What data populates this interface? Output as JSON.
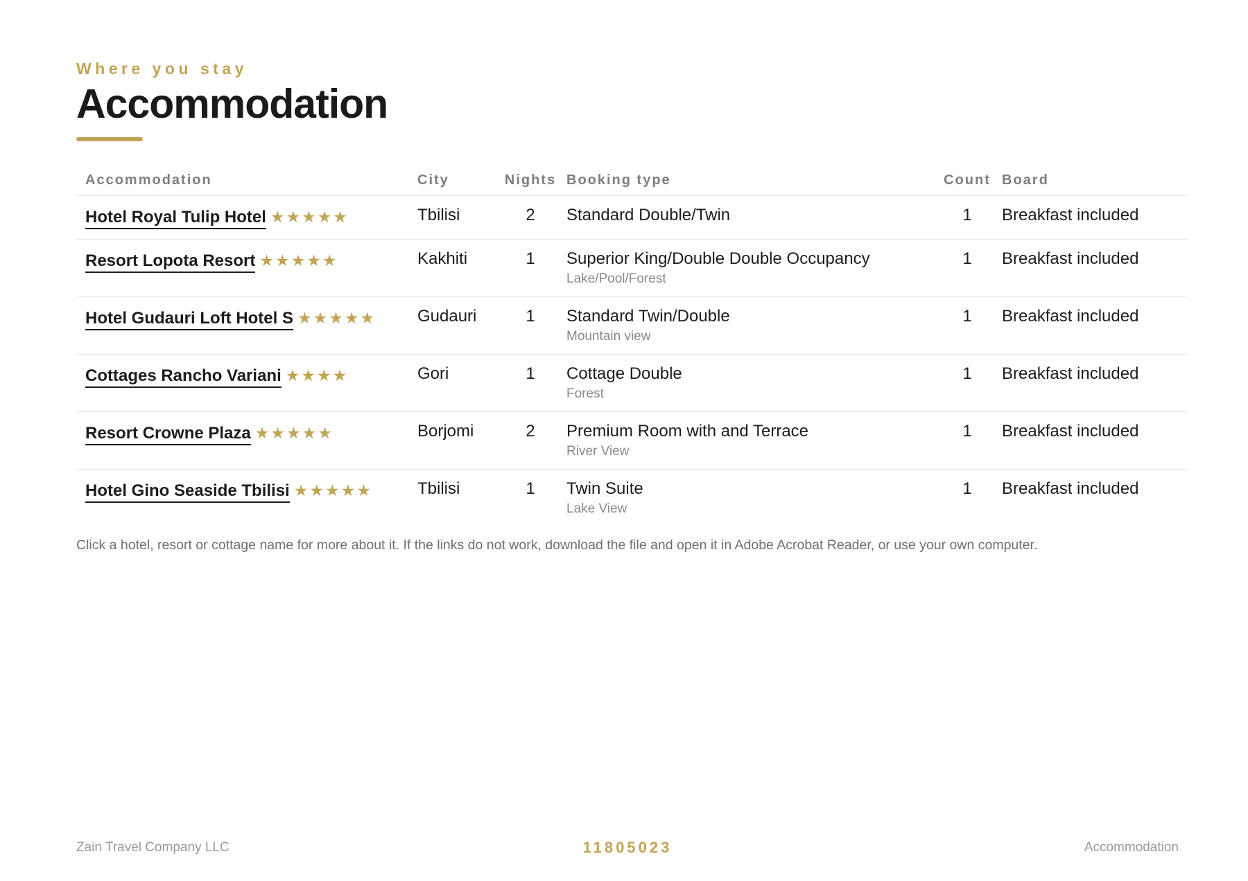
{
  "header": {
    "eyebrow": "Where you stay",
    "title": "Accommodation"
  },
  "table": {
    "columns": [
      "Accommodation",
      "City",
      "Nights",
      "Booking type",
      "Count",
      "Board"
    ],
    "rows": [
      {
        "name": "Hotel Royal Tulip Hotel",
        "stars": "★★★★★",
        "star_rating": 5,
        "city": "Tbilisi",
        "nights": "2",
        "booking_type": "Standard Double/Twin",
        "booking_note": "",
        "count": "1",
        "board": "Breakfast included"
      },
      {
        "name": "Resort Lopota Resort",
        "stars": "★★★★★",
        "star_rating": 5,
        "city": "Kakhiti",
        "nights": "1",
        "booking_type": "Superior King/Double Double Occupancy",
        "booking_note": "Lake/Pool/Forest",
        "count": "1",
        "board": "Breakfast included"
      },
      {
        "name": "Hotel Gudauri Loft Hotel S",
        "stars": "★★★★★",
        "star_rating": 5,
        "city": "Gudauri",
        "nights": "1",
        "booking_type": "Standard Twin/Double",
        "booking_note": "Mountain view",
        "count": "1",
        "board": "Breakfast included"
      },
      {
        "name": "Cottages Rancho Variani",
        "stars": "★★★★",
        "star_rating": 4,
        "city": "Gori",
        "nights": "1",
        "booking_type": "Cottage Double",
        "booking_note": "Forest",
        "count": "1",
        "board": "Breakfast included"
      },
      {
        "name": "Resort Crowne Plaza",
        "stars": "★★★★★",
        "star_rating": 5,
        "city": "Borjomi",
        "nights": "2",
        "booking_type": "Premium Room with and Terrace",
        "booking_note": "River View",
        "count": "1",
        "board": "Breakfast included"
      },
      {
        "name": "Hotel Gino Seaside Tbilisi",
        "stars": "★★★★★",
        "star_rating": 5,
        "city": "Tbilisi",
        "nights": "1",
        "booking_type": "Twin Suite",
        "booking_note": "Lake View",
        "count": "1",
        "board": "Breakfast included"
      }
    ]
  },
  "note": "Click a hotel, resort or cottage name for more about it. If the links do not work, download the file and open it in Adobe Acrobat Reader, or use your own computer.",
  "footer": {
    "company": "Zain Travel Company LLC",
    "reference": "11805023",
    "section": "Accommodation"
  },
  "colors": {
    "accent": "#c2a553",
    "text": "#1c1c1c",
    "muted": "#7d7d82"
  }
}
